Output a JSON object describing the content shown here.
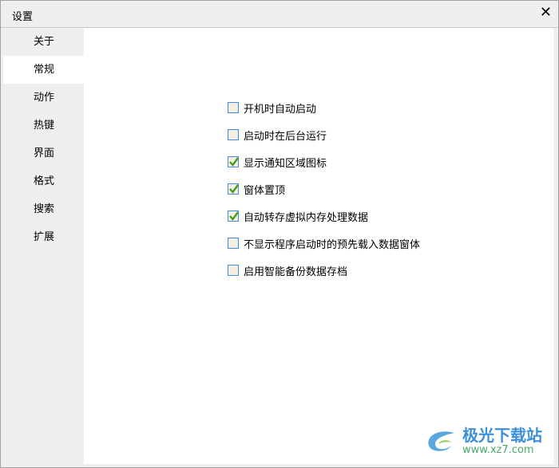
{
  "window": {
    "title": "设置",
    "close_label": "✕"
  },
  "sidebar": {
    "items": [
      {
        "label": "关于",
        "active": false
      },
      {
        "label": "常规",
        "active": true
      },
      {
        "label": "动作",
        "active": false
      },
      {
        "label": "热键",
        "active": false
      },
      {
        "label": "界面",
        "active": false
      },
      {
        "label": "格式",
        "active": false
      },
      {
        "label": "搜索",
        "active": false
      },
      {
        "label": "扩展",
        "active": false
      }
    ]
  },
  "options": [
    {
      "label": "开机时自动启动",
      "checked": false
    },
    {
      "label": "启动时在后台运行",
      "checked": false
    },
    {
      "label": "显示通知区域图标",
      "checked": true
    },
    {
      "label": "窗体置顶",
      "checked": true
    },
    {
      "label": "自动转存虚拟内存处理数据",
      "checked": true
    },
    {
      "label": "不显示程序启动时的预先载入数据窗体",
      "checked": false
    },
    {
      "label": "启用智能备份数据存档",
      "checked": false
    }
  ],
  "watermark": {
    "name": "极光下载站",
    "url": "www.xz7.com"
  },
  "colors": {
    "check": "#4a9a1e",
    "checkbox_border": "#3a8ee6"
  }
}
